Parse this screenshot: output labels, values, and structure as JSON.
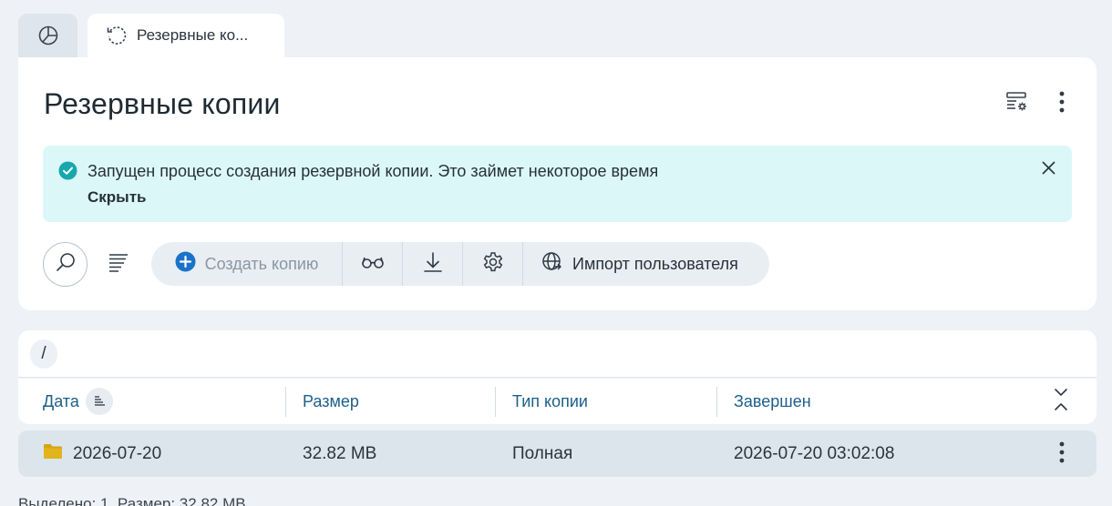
{
  "tabs": [
    {
      "icon": "pie-chart-icon"
    },
    {
      "icon": "backup-refresh-icon",
      "label": "Резервные ко..."
    }
  ],
  "page": {
    "title": "Резервные копии"
  },
  "header_actions": {
    "view_settings_icon": "view-settings-icon",
    "more_icon": "more-vertical-icon"
  },
  "notice": {
    "text": "Запущен процесс создания резервной копии. Это займет некоторое время",
    "hide_label": "Скрыть",
    "color": "#dcf7f8",
    "icon_color": "#17a8ad"
  },
  "toolbar": {
    "create_label": "Создать копию",
    "import_label": "Импорт пользователя",
    "accent": "#1a73c9"
  },
  "path": {
    "label": "/"
  },
  "table": {
    "columns": [
      "Дата",
      "Размер",
      "Тип копии",
      "Завершен"
    ],
    "rows": [
      {
        "date": "2026-07-20",
        "size": "32.82 MB",
        "type": "Полная",
        "finished": "2026-07-20 03:02:08"
      }
    ]
  },
  "footer": {
    "text": "Выделено: 1. Размер: 32.82 MB"
  }
}
